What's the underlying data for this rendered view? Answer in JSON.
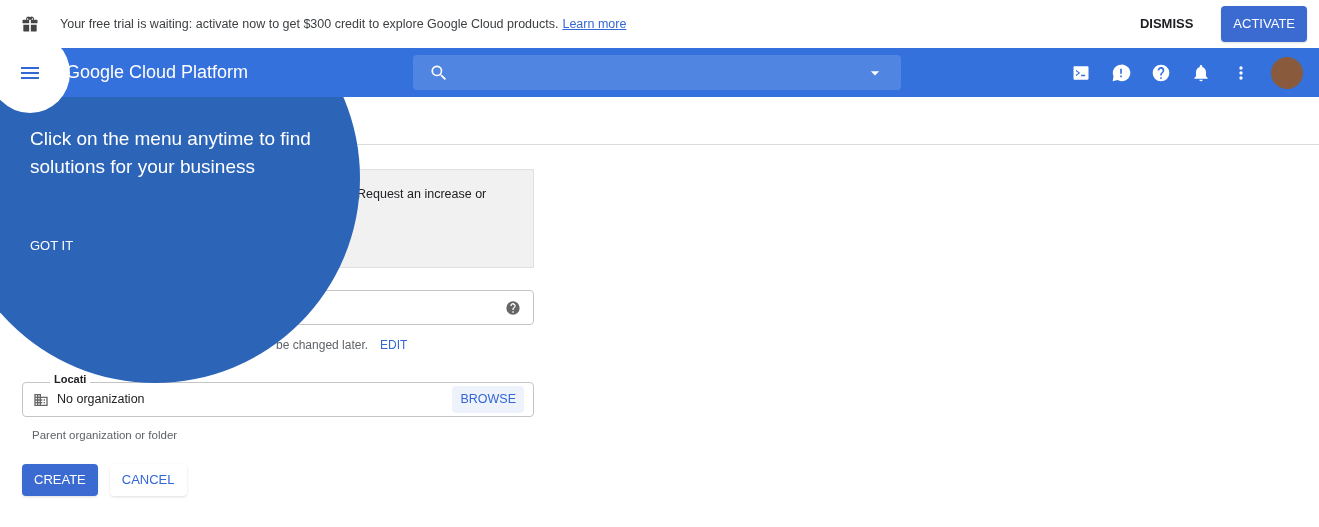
{
  "banner": {
    "message": "Your free trial is waiting: activate now to get $300 credit to explore Google Cloud products.",
    "link": "Learn more",
    "buttons": [
      "DISMISS",
      "ACTIVATE"
    ]
  },
  "header": {
    "title": "Google Cloud Platform"
  },
  "form": {
    "notice": "Request an increase or",
    "name_help": "be changed later.",
    "edit": "EDIT",
    "location_label": "Locati",
    "location_value": "No organization",
    "browse": "BROWSE",
    "location_help": "Parent organization or folder",
    "buttons": [
      "CREATE",
      "CANCEL"
    ]
  },
  "tour": {
    "message": "Click on the menu anytime to find solutions for your business",
    "action": "GOT IT"
  }
}
